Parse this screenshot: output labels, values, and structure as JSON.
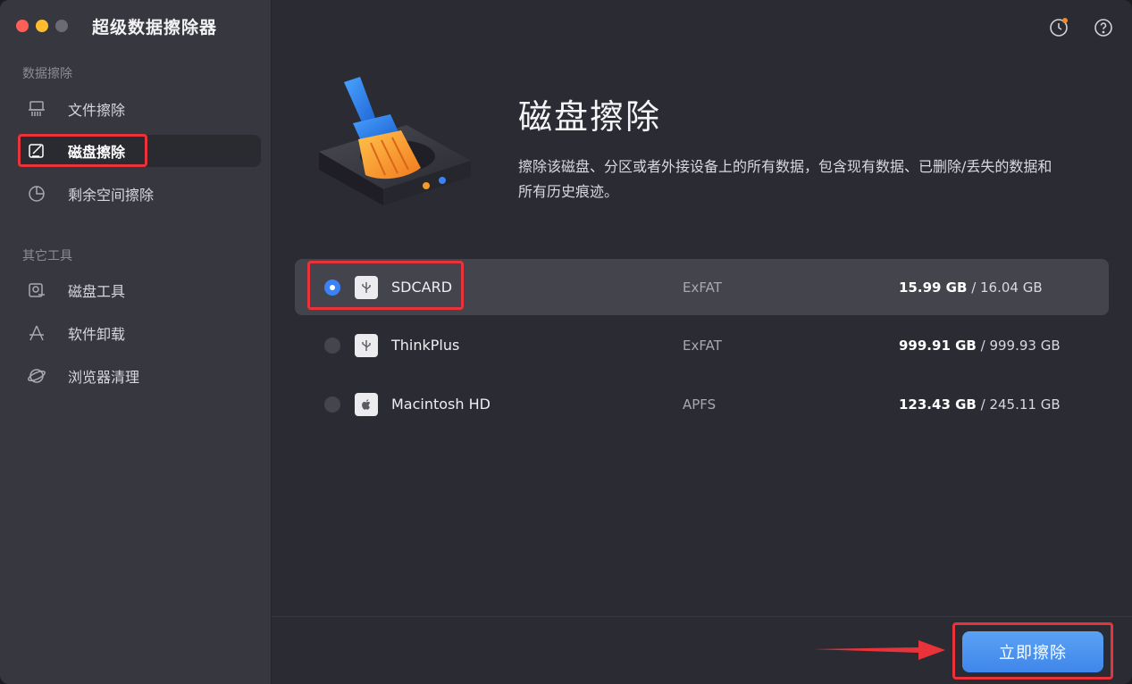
{
  "app": {
    "title": "超级数据擦除器"
  },
  "sidebar": {
    "section_data": "数据擦除",
    "section_tools": "其它工具",
    "items": [
      {
        "label": "文件擦除",
        "icon": "shredder-icon"
      },
      {
        "label": "磁盘擦除",
        "icon": "disk-edit-icon",
        "active": true
      },
      {
        "label": "剩余空间擦除",
        "icon": "pie-chart-icon"
      },
      {
        "label": "磁盘工具",
        "icon": "disk-tool-icon"
      },
      {
        "label": "软件卸载",
        "icon": "app-uninstall-icon"
      },
      {
        "label": "浏览器清理",
        "icon": "browser-clean-icon"
      }
    ]
  },
  "header": {
    "icons": [
      "history-icon",
      "help-icon"
    ]
  },
  "hero": {
    "title": "磁盘擦除",
    "description": "擦除该磁盘、分区或者外接设备上的所有数据，包含现有数据、已删除/丢失的数据和所有历史痕迹。"
  },
  "drives": [
    {
      "name": "SDCARD",
      "fs": "ExFAT",
      "used": "15.99 GB",
      "total": " / 16.04 GB",
      "selected": true,
      "icon": "usb-icon"
    },
    {
      "name": "ThinkPlus",
      "fs": "ExFAT",
      "used": "999.91 GB",
      "total": " / 999.93 GB",
      "selected": false,
      "icon": "usb-icon"
    },
    {
      "name": "Macintosh HD",
      "fs": "APFS",
      "used": "123.43 GB",
      "total": " / 245.11 GB",
      "selected": false,
      "icon": "apple-icon"
    }
  ],
  "footer": {
    "erase_label": "立即擦除"
  },
  "colors": {
    "accent": "#3b82f6",
    "highlight": "#e8333a",
    "background": "#2b2b33",
    "sidebar": "#37373f"
  }
}
